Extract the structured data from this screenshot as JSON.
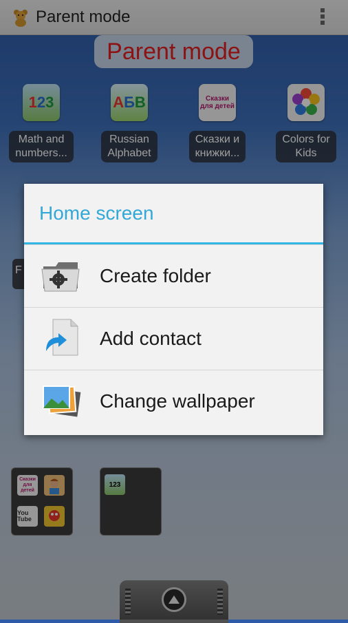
{
  "action_bar": {
    "title": "Parent mode",
    "logo_icon": "teddy-bear-icon",
    "overflow_icon": "overflow-menu-icon"
  },
  "banner": {
    "text": "Parent mode"
  },
  "apps": [
    {
      "label_line1": "Math and",
      "label_line2": "numbers...",
      "icon": "numbers-123-icon",
      "glyph": "123"
    },
    {
      "label_line1": "Russian",
      "label_line2": "Alphabet",
      "icon": "alphabet-abv-icon",
      "glyph": "АБВ"
    },
    {
      "label_line1": "Сказки и",
      "label_line2": "книжки...",
      "icon": "fairytales-book-icon",
      "glyph": "Сказки для детей"
    },
    {
      "label_line1": "Colors for",
      "label_line2": "Kids",
      "icon": "color-flower-icon"
    }
  ],
  "partial_label": "F",
  "dialog": {
    "title": "Home screen",
    "items": [
      {
        "label": "Create folder",
        "icon": "folder-gear-icon"
      },
      {
        "label": "Add contact",
        "icon": "contact-shortcut-icon"
      },
      {
        "label": "Change wallpaper",
        "icon": "wallpaper-photos-icon"
      }
    ]
  },
  "folders": [
    {
      "mini_labels": [
        "Сказки для детей",
        "",
        "You Tube",
        ""
      ]
    },
    {
      "mini_labels": [
        "123"
      ]
    }
  ],
  "dock": {
    "icon": "up-arrow-icon"
  },
  "colors": {
    "accent": "#33b5e5",
    "banner_text": "#e02020"
  }
}
